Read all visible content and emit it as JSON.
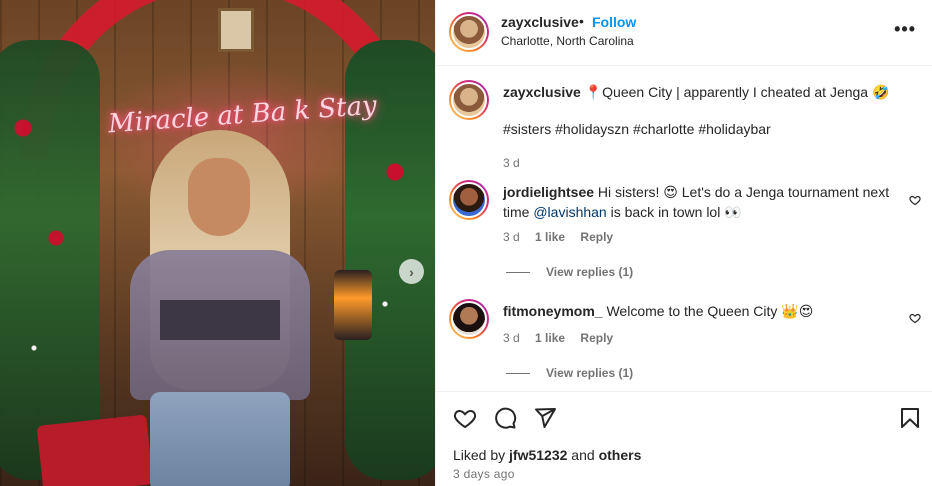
{
  "post": {
    "username": "zayxclusive",
    "follow_label": "Follow",
    "separator": "•",
    "location": "Charlotte, North Carolina",
    "more_label": "•••"
  },
  "photo": {
    "neon_text": "Miracle at Ba k Stay",
    "next_arrow": "›"
  },
  "caption": {
    "username": "zayxclusive",
    "text": "📍Queen City | apparently I cheated at Jenga 🤣",
    "hashtags": "#sisters #holidayszn #charlotte #holidaybar",
    "time": "3 d"
  },
  "comments": [
    {
      "username": "jordielightsee",
      "text_before": "Hi sisters! 😍 Let's do a Jenga tournament next time ",
      "mention": "@lavishhan",
      "text_after": " is back in town lol 👀",
      "time": "3 d",
      "likes": "1 like",
      "reply": "Reply",
      "view_replies": "View replies (1)"
    },
    {
      "username": "fitmoneymom_",
      "text_before": "Welcome to the Queen City 👑😍",
      "mention": "",
      "text_after": "",
      "time": "3 d",
      "likes": "1 like",
      "reply": "Reply",
      "view_replies": "View replies (1)"
    }
  ],
  "footer": {
    "liked_by_prefix": "Liked by ",
    "liked_by_user": "jfw51232",
    "liked_by_and": " and ",
    "liked_by_others": "others",
    "time_ago": "3 days ago"
  },
  "icons": [
    "heart-icon",
    "comment-icon",
    "share-icon",
    "bookmark-icon",
    "more-icon",
    "next-arrow-icon"
  ]
}
